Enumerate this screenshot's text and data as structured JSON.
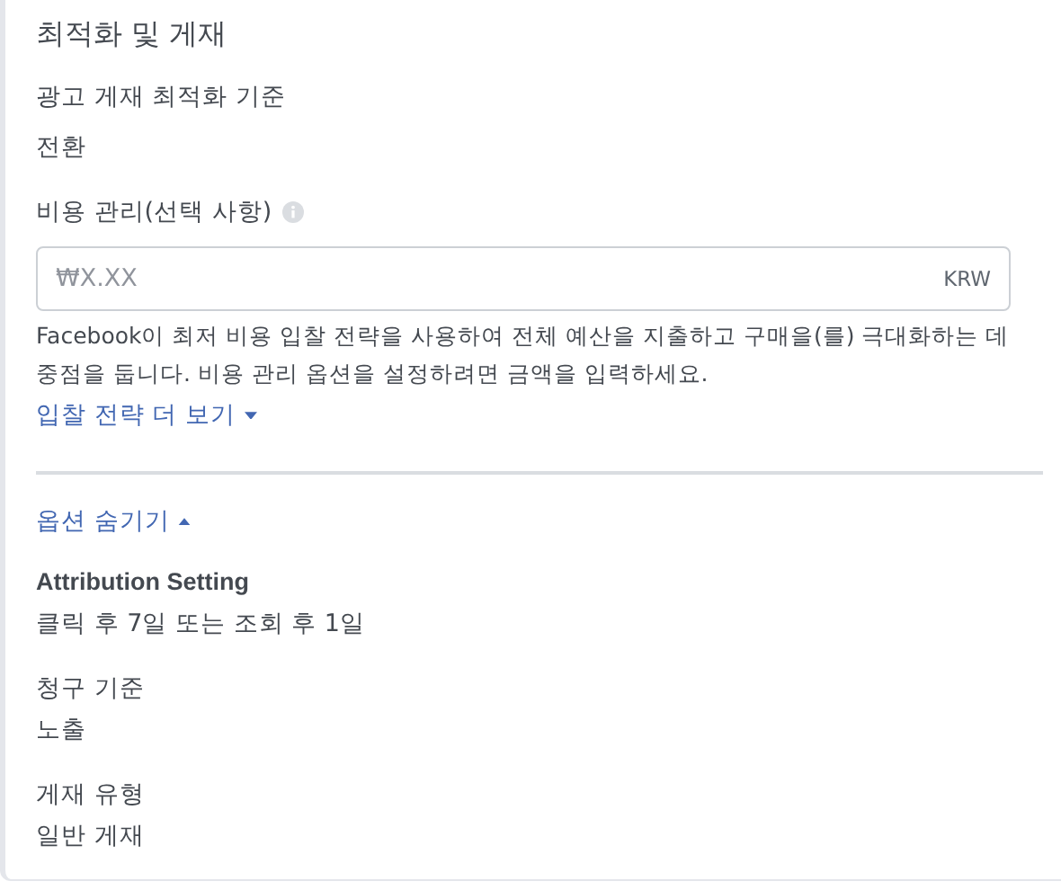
{
  "section": {
    "title": "최적화 및 게재"
  },
  "delivery": {
    "label": "광고 게재 최적화 기준",
    "value": "전환"
  },
  "cost_control": {
    "label": "비용 관리(선택 사항)",
    "placeholder": "₩X.XX",
    "currency": "KRW",
    "help": "Facebook이 최저 비용 입찰 전략을 사용하여 전체 예산을 지출하고 구매을(를) 극대화하는 데 중점을 둡니다. 비용 관리 옵션을 설정하려면 금액을 입력하세요.",
    "link": {
      "label": "입찰 전략 더 보기",
      "expanded": false
    }
  },
  "options_toggle": {
    "label": "옵션 숨기기",
    "expanded": true
  },
  "options": [
    {
      "kind": "strong",
      "label": "Attribution Setting",
      "value": "클릭 후 7일 또는 조회 후 1일"
    },
    {
      "kind": "plain",
      "label": "청구 기준",
      "value": "노출"
    },
    {
      "kind": "plain",
      "label": "게재 유형",
      "value": "일반 게재"
    }
  ]
}
